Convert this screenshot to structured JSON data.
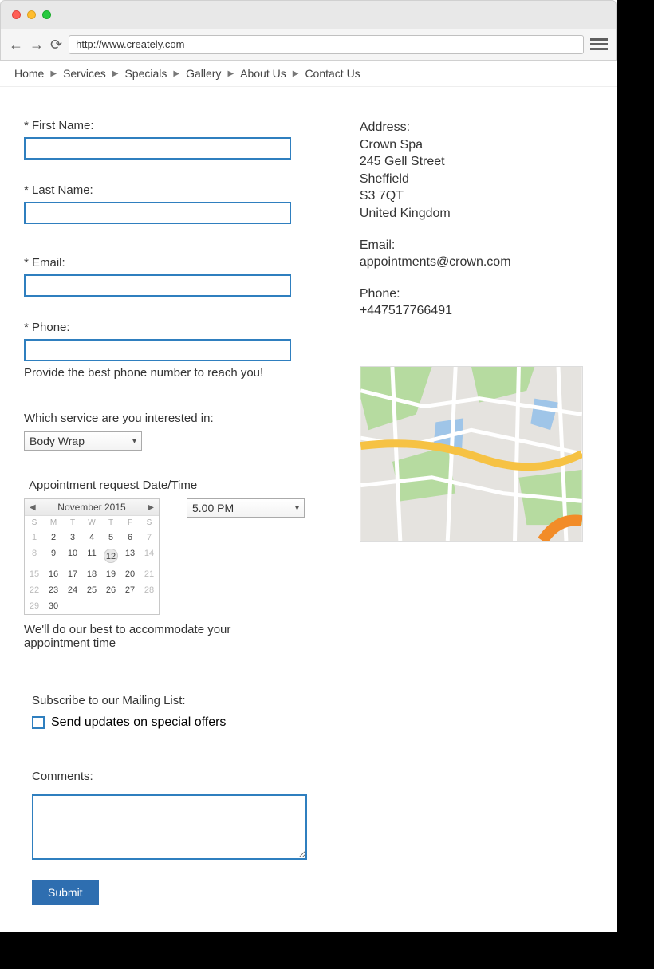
{
  "browser": {
    "url": "http://www.creately.com"
  },
  "nav": {
    "items": [
      "Home",
      "Services",
      "Specials",
      "Gallery",
      "About Us",
      "Contact Us"
    ]
  },
  "form": {
    "firstName": {
      "label": "* First Name:",
      "value": ""
    },
    "lastName": {
      "label": "* Last Name:",
      "value": ""
    },
    "email": {
      "label": "* Email:",
      "value": ""
    },
    "phone": {
      "label": "* Phone:",
      "value": "",
      "help": "Provide the best phone number to reach you!"
    },
    "serviceQuestion": "Which service are you interested in:",
    "serviceSelected": "Body Wrap",
    "appointmentLabel": "Appointment request Date/Time",
    "timeSelected": "5.00 PM",
    "appointmentNote": "We'll do our best to accommodate your appointment time",
    "subscribeLabel": "Subscribe to our Mailing List:",
    "subscribeOption": "Send updates on special offers",
    "commentsLabel": "Comments:",
    "submitLabel": "Submit"
  },
  "calendar": {
    "monthLabel": "November 2015",
    "dow": [
      "S",
      "M",
      "T",
      "W",
      "T",
      "F",
      "S"
    ],
    "rows": [
      [
        {
          "n": "1",
          "muted": true
        },
        {
          "n": "2"
        },
        {
          "n": "3"
        },
        {
          "n": "4"
        },
        {
          "n": "5"
        },
        {
          "n": "6"
        },
        {
          "n": "7",
          "muted": true
        }
      ],
      [
        {
          "n": "8",
          "muted": true
        },
        {
          "n": "9"
        },
        {
          "n": "10"
        },
        {
          "n": "11"
        },
        {
          "n": "12",
          "selected": true
        },
        {
          "n": "13"
        },
        {
          "n": "14",
          "muted": true
        }
      ],
      [
        {
          "n": "15",
          "muted": true
        },
        {
          "n": "16"
        },
        {
          "n": "17"
        },
        {
          "n": "18"
        },
        {
          "n": "19"
        },
        {
          "n": "20"
        },
        {
          "n": "21",
          "muted": true
        }
      ],
      [
        {
          "n": "22",
          "muted": true
        },
        {
          "n": "23"
        },
        {
          "n": "24"
        },
        {
          "n": "25"
        },
        {
          "n": "26"
        },
        {
          "n": "27"
        },
        {
          "n": "28",
          "muted": true
        }
      ],
      [
        {
          "n": "29",
          "muted": true
        },
        {
          "n": "30"
        },
        {
          "n": ""
        },
        {
          "n": ""
        },
        {
          "n": ""
        },
        {
          "n": ""
        },
        {
          "n": ""
        }
      ]
    ]
  },
  "contact": {
    "addressLabel": "Address:",
    "lines": [
      "Crown Spa",
      "245 Gell Street",
      "Sheffield",
      "S3 7QT",
      "United Kingdom"
    ],
    "emailLabel": "Email:",
    "email": "appointments@crown.com",
    "phoneLabel": "Phone:",
    "phone": "+447517766491"
  }
}
